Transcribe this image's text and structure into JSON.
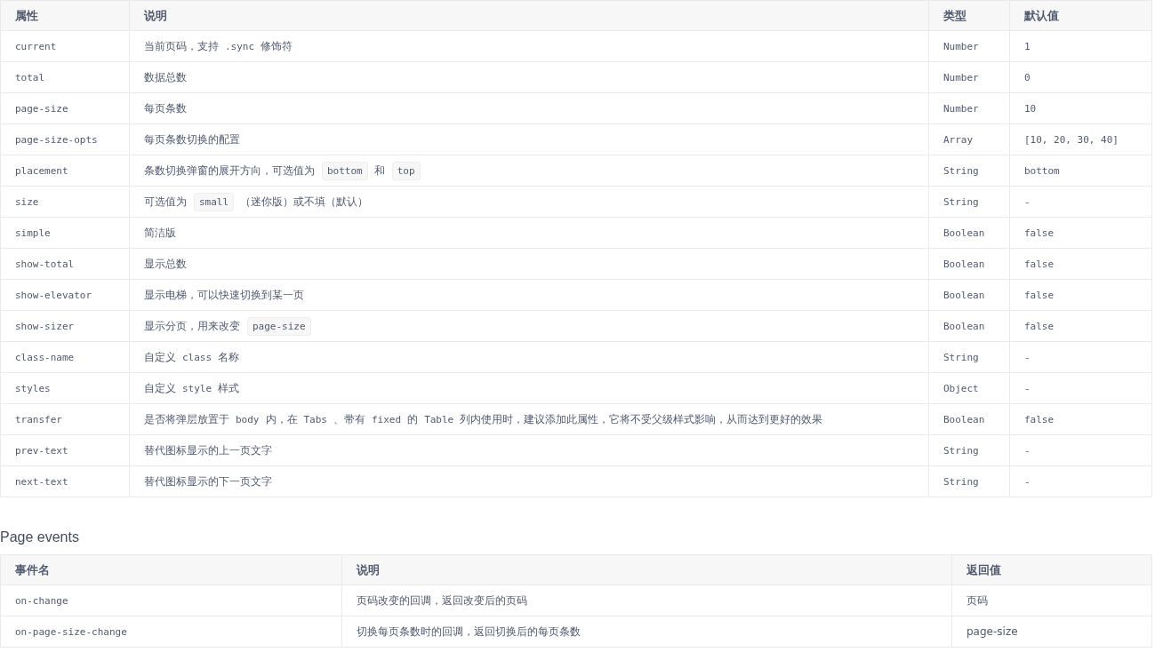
{
  "props_table": {
    "columns": [
      "属性",
      "说明",
      "类型",
      "默认值"
    ],
    "rows": [
      {
        "name": "current",
        "desc": [
          {
            "kind": "text",
            "text": "当前页码，支持"
          },
          {
            "kind": "mono",
            "text": ".sync"
          },
          {
            "kind": "text",
            "text": "修饰符"
          }
        ],
        "type": "Number",
        "default": "1"
      },
      {
        "name": "total",
        "desc": [
          {
            "kind": "text",
            "text": "数据总数"
          }
        ],
        "type": "Number",
        "default": "0"
      },
      {
        "name": "page-size",
        "desc": [
          {
            "kind": "text",
            "text": "每页条数"
          }
        ],
        "type": "Number",
        "default": "10"
      },
      {
        "name": "page-size-opts",
        "desc": [
          {
            "kind": "text",
            "text": "每页条数切换的配置"
          }
        ],
        "type": "Array",
        "default": "[10, 20, 30, 40]"
      },
      {
        "name": "placement",
        "desc": [
          {
            "kind": "text",
            "text": "条数切换弹窗的展开方向，可选值为"
          },
          {
            "kind": "chip",
            "text": "bottom"
          },
          {
            "kind": "text",
            "text": "和"
          },
          {
            "kind": "chip",
            "text": "top"
          }
        ],
        "type": "String",
        "default": "bottom"
      },
      {
        "name": "size",
        "desc": [
          {
            "kind": "text",
            "text": "可选值为"
          },
          {
            "kind": "chip",
            "text": "small"
          },
          {
            "kind": "text",
            "text": "（迷你版）或不填（默认）"
          }
        ],
        "type": "String",
        "default": "-"
      },
      {
        "name": "simple",
        "desc": [
          {
            "kind": "text",
            "text": "简洁版"
          }
        ],
        "type": "Boolean",
        "default": "false"
      },
      {
        "name": "show-total",
        "desc": [
          {
            "kind": "text",
            "text": "显示总数"
          }
        ],
        "type": "Boolean",
        "default": "false"
      },
      {
        "name": "show-elevator",
        "desc": [
          {
            "kind": "text",
            "text": "显示电梯，可以快速切换到某一页"
          }
        ],
        "type": "Boolean",
        "default": "false"
      },
      {
        "name": "show-sizer",
        "desc": [
          {
            "kind": "text",
            "text": "显示分页，用来改变"
          },
          {
            "kind": "chip",
            "text": "page-size"
          }
        ],
        "type": "Boolean",
        "default": "false"
      },
      {
        "name": "class-name",
        "desc": [
          {
            "kind": "text",
            "text": "自定义"
          },
          {
            "kind": "mono",
            "text": "class"
          },
          {
            "kind": "text",
            "text": "名称"
          }
        ],
        "type": "String",
        "default": "-"
      },
      {
        "name": "styles",
        "desc": [
          {
            "kind": "text",
            "text": "自定义"
          },
          {
            "kind": "mono",
            "text": "style"
          },
          {
            "kind": "text",
            "text": "样式"
          }
        ],
        "type": "Object",
        "default": "-"
      },
      {
        "name": "transfer",
        "desc": [
          {
            "kind": "text",
            "text": "是否将弹层放置于"
          },
          {
            "kind": "mono",
            "text": "body"
          },
          {
            "kind": "text",
            "text": "内，在"
          },
          {
            "kind": "mono",
            "text": "Tabs"
          },
          {
            "kind": "text",
            "text": "、带有"
          },
          {
            "kind": "mono",
            "text": "fixed"
          },
          {
            "kind": "text",
            "text": "的"
          },
          {
            "kind": "mono",
            "text": "Table"
          },
          {
            "kind": "text",
            "text": "列内使用时，建议添加此属性，它将不受父级样式影响，从而达到更好的效果"
          }
        ],
        "type": "Boolean",
        "default": "false"
      },
      {
        "name": "prev-text",
        "desc": [
          {
            "kind": "text",
            "text": "替代图标显示的上一页文字"
          }
        ],
        "type": "String",
        "default": "-"
      },
      {
        "name": "next-text",
        "desc": [
          {
            "kind": "text",
            "text": "替代图标显示的下一页文字"
          }
        ],
        "type": "String",
        "default": "-"
      }
    ]
  },
  "events_heading": "Page events",
  "events_table": {
    "columns": [
      "事件名",
      "说明",
      "返回值"
    ],
    "rows": [
      {
        "name": "on-change",
        "desc": "页码改变的回调，返回改变后的页码",
        "returns": "页码"
      },
      {
        "name": "on-page-size-change",
        "desc": "切换每页条数时的回调，返回切换后的每页条数",
        "returns": "page-size"
      }
    ]
  }
}
